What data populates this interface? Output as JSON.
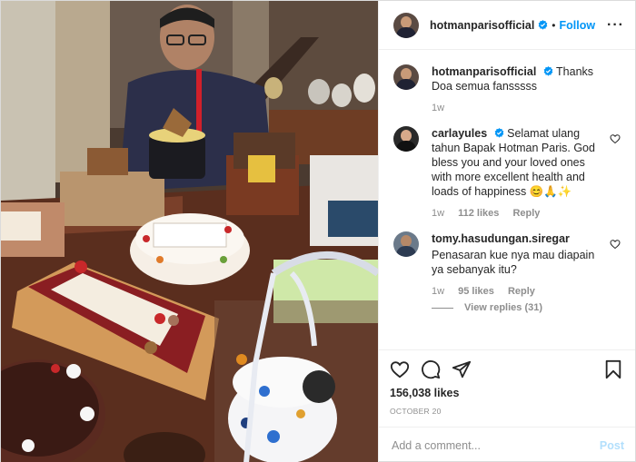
{
  "post": {
    "username": "hotmanparisofficial",
    "follow_label": "Follow",
    "separator": "•",
    "more_label": "···"
  },
  "caption": {
    "username": "hotmanparisofficial",
    "text": "Thanks Doa semua fansssss",
    "time": "1w"
  },
  "comments": [
    {
      "username": "carlayules",
      "text": "Selamat ulang tahun Bapak Hotman Paris. God bless you and your loved ones with more excellent health and loads of happiness 😊🙏✨",
      "time": "1w",
      "likes": "112 likes",
      "reply": "Reply"
    },
    {
      "username": "tomy.hasudungan.siregar",
      "text": "Penasaran kue nya mau diapain ya sebanyak itu?",
      "time": "1w",
      "likes": "95 likes",
      "reply": "Reply",
      "view_replies": "View replies (31)"
    }
  ],
  "footer": {
    "likes": "156,038 likes",
    "date": "OCTOBER 20",
    "comment_placeholder": "Add a comment...",
    "post_label": "Post"
  },
  "icons": {
    "like": "heart-outline-icon",
    "comment": "comment-bubble-icon",
    "share": "paper-plane-icon",
    "save": "bookmark-icon",
    "verified": "verified-badge-icon"
  },
  "colors": {
    "link_blue": "#0095f6",
    "post_disabled": "#b2dffc",
    "meta_gray": "#8e8e8e",
    "text": "#262626"
  }
}
